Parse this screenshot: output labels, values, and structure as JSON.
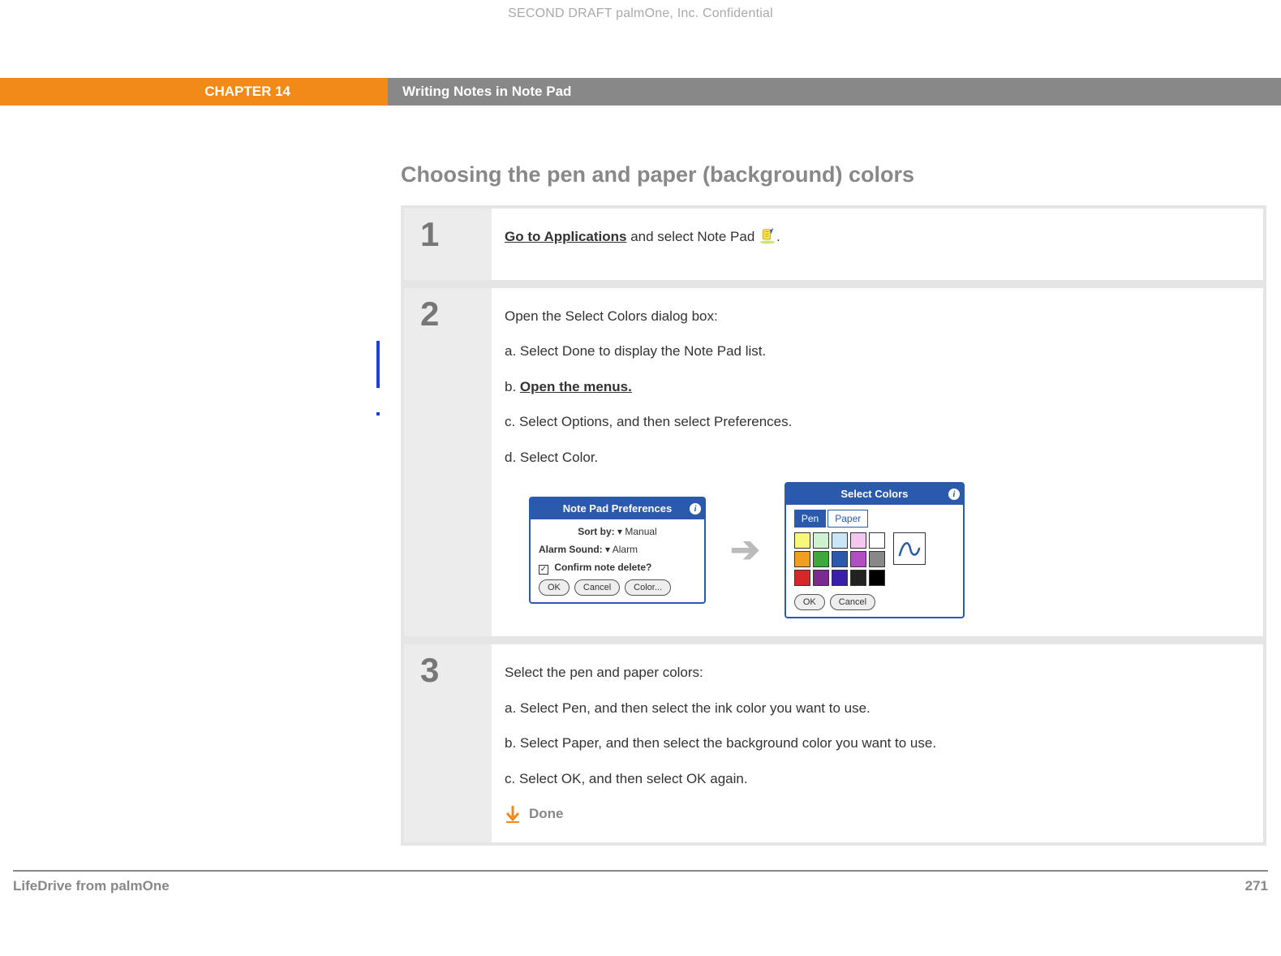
{
  "confidential": "SECOND DRAFT palmOne, Inc.  Confidential",
  "header": {
    "chapter": "CHAPTER 14",
    "title": "Writing Notes in Note Pad"
  },
  "section_title": "Choosing the pen and paper (background) colors",
  "steps": {
    "s1": {
      "num": "1",
      "link": "Go to Applications",
      "rest": " and select Note Pad ",
      "period": "."
    },
    "s2": {
      "num": "2",
      "intro": "Open the Select Colors dialog box:",
      "a": "a.  Select Done to display the Note Pad list.",
      "b_pre": "b.  ",
      "b_link": "Open the menus.",
      "c": "c.  Select Options, and then select Preferences.",
      "d": "d.  Select Color."
    },
    "s3": {
      "num": "3",
      "intro": "Select the pen and paper colors:",
      "a": "a.  Select Pen, and then select the ink color you want to use.",
      "b": "b.  Select Paper, and then select the background color you want to use.",
      "c": "c.  Select OK, and then select OK again.",
      "done": "Done"
    }
  },
  "pref_dialog": {
    "title": "Note Pad Preferences",
    "sort_label": "Sort by:",
    "sort_value": "Manual",
    "alarm_label": "Alarm Sound:",
    "alarm_value": "Alarm",
    "confirm": "Confirm note delete?",
    "ok": "OK",
    "cancel": "Cancel",
    "color": "Color..."
  },
  "colors_dialog": {
    "title": "Select Colors",
    "pen": "Pen",
    "paper": "Paper",
    "ok": "OK",
    "cancel": "Cancel"
  },
  "footer": {
    "left": "LifeDrive from palmOne",
    "right": "271"
  },
  "palette_colors": [
    "#f7f77a",
    "#cff1cf",
    "#c8e6f6",
    "#f4c8ee",
    "#ffffff",
    "#f0a020",
    "#3da93d",
    "#2b5aad",
    "#b050c0",
    "#888888",
    "#d62828",
    "#7a2b8d",
    "#3a1fa8",
    "#222222",
    "#000000"
  ]
}
